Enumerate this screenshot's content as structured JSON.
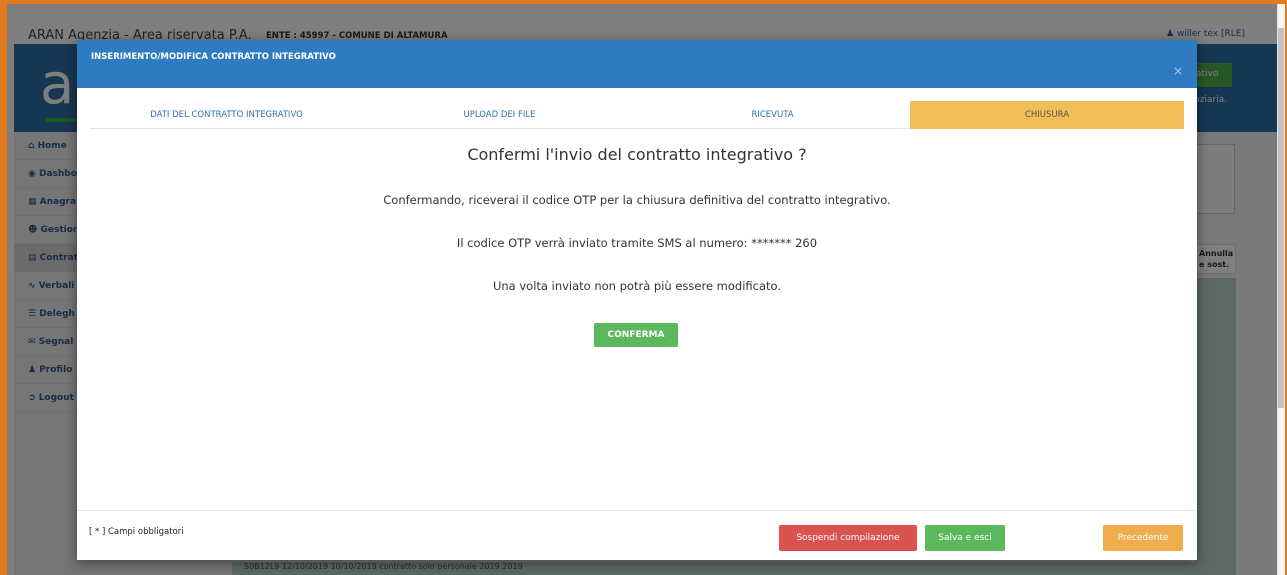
{
  "background": {
    "app_title": "ARAN Agenzia - Area riservata P.A.",
    "ente": "ENTE : 45997 - COMUNE DI ALTAMURA",
    "user": "willer tex [RLE]",
    "green_button_partial": "ativo",
    "banner_partial_text": "nziaria.",
    "sidebar": [
      {
        "icon": "home-icon",
        "label": "Home"
      },
      {
        "icon": "dashboard-icon",
        "label": "Dashbo"
      },
      {
        "icon": "registry-icon",
        "label": "Anagra"
      },
      {
        "icon": "users-icon",
        "label": "Gestion"
      },
      {
        "icon": "contract-icon",
        "label": "Contrat"
      },
      {
        "icon": "signature-icon",
        "label": "Verbali"
      },
      {
        "icon": "list-icon",
        "label": "Delegh"
      },
      {
        "icon": "report-icon",
        "label": "Segnal"
      },
      {
        "icon": "user-icon",
        "label": "Profilo"
      },
      {
        "icon": "logout-icon",
        "label": "Logout"
      }
    ],
    "table_header_partial": "Annulla e sost.",
    "bottom_row_partial": "S0B12L9   12/10/2019   10/10/2019   contratto   solo   personale   2019   2019"
  },
  "modal": {
    "title": "INSERIMENTO/MODIFICA CONTRATTO INTEGRATIVO",
    "close_icon": "×",
    "tabs": [
      {
        "label": "DATI DEL CONTRATTO INTEGRATIVO",
        "active": false
      },
      {
        "label": "UPLOAD DEI FILE",
        "active": false
      },
      {
        "label": "RICEVUTA",
        "active": false
      },
      {
        "label": "CHIUSURA",
        "active": true
      }
    ],
    "confirm_title": "Confermi l'invio del contratto integrativo ?",
    "message_1": "Confermando, riceverai il codice OTP per la chiusura definitiva del contratto integrativo.",
    "message_2": "Il codice OTP verrà inviato tramite SMS al numero: ******* 260",
    "message_3": "Una volta inviato non potrà più essere modificato.",
    "confirm_button": "CONFERMA",
    "footer": {
      "required_note": "[ * ] Campi obbligatori",
      "suspend_button": "Sospendi compilazione",
      "save_exit_button": "Salva e esci",
      "previous_button": "Precedente"
    }
  },
  "colors": {
    "header_blue": "#2f7bc2",
    "active_tab": "#f0be57",
    "confirm_green": "#5cb85c",
    "suspend_red": "#d9534f",
    "previous_orange": "#f0ad4e",
    "frame_orange": "#e07a1f"
  }
}
